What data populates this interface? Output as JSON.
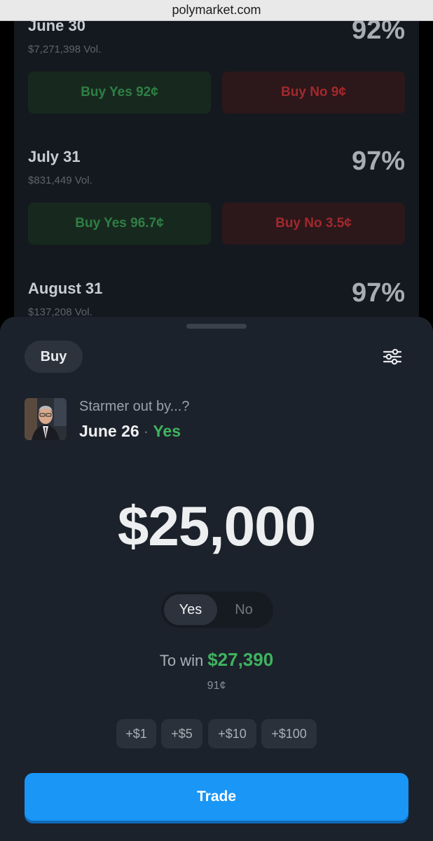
{
  "browser": {
    "url": "polymarket.com"
  },
  "markets": [
    {
      "title": "June 30",
      "volume": "$7,271,398 Vol.",
      "percent": "92%",
      "buy_yes": "Buy Yes 92¢",
      "buy_no": "Buy No 9¢"
    },
    {
      "title": "July 31",
      "volume": "$831,449 Vol.",
      "percent": "97%",
      "buy_yes": "Buy Yes 96.7¢",
      "buy_no": "Buy No 3.5¢"
    },
    {
      "title": "August 31",
      "volume": "$137,208 Vol.",
      "percent": "97%"
    }
  ],
  "sheet": {
    "mode_label": "Buy",
    "question": "Starmer out by...?",
    "outcome": "June 26",
    "separator": "·",
    "side": "Yes",
    "amount": "$25,000",
    "toggle": {
      "yes": "Yes",
      "no": "No",
      "selected": "Yes"
    },
    "to_win_label": "To win",
    "to_win_value": "$27,390",
    "price": "91¢",
    "chips": [
      "+$1",
      "+$5",
      "+$10",
      "+$100"
    ],
    "trade_label": "Trade"
  },
  "colors": {
    "accent_blue": "#1996f6",
    "yes_green": "#3fb35f",
    "no_red": "#a2292d",
    "sheet_bg": "#1c222b"
  },
  "icons": {
    "settings": "sliders-icon"
  }
}
